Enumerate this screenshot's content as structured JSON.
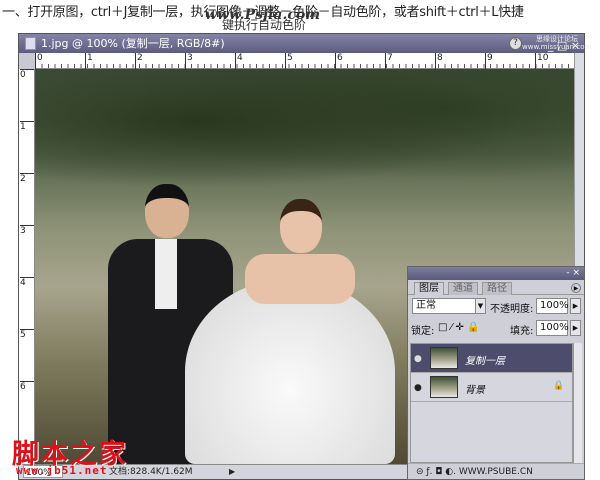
{
  "caption": {
    "line1": "一、打开原图，ctrl＋J复制一层，执行图像－调整－色阶－自动色阶，或者shift＋ctrl＋L快捷",
    "line2": "键执行自动色阶",
    "watermark": "www.Psjia.com"
  },
  "window": {
    "title": "1.jpg @ 100% (复制一层, RGB/8#)",
    "corner_watermark": "思缘设计论坛 www.missyuan.com",
    "buttons": "_ □ ×"
  },
  "ruler": {
    "top": [
      "0",
      "1",
      "2",
      "3",
      "4",
      "5",
      "6",
      "7",
      "8",
      "9",
      "10"
    ],
    "left": [
      "0",
      "1",
      "2",
      "3",
      "4",
      "5",
      "6"
    ]
  },
  "status": {
    "zoom": "100%",
    "doc": "文档:828.4K/1.62M",
    "arrow": "▶"
  },
  "watermark": {
    "brand": "脚本之家",
    "url": "www.jb51.net"
  },
  "layers_panel": {
    "title_buttons": "- ×",
    "tabs": [
      "图层",
      "通道",
      "路径"
    ],
    "blend_mode": "正常",
    "opacity_label": "不透明度:",
    "opacity": "100%",
    "lock_label": "锁定:",
    "lock_icons": "□ ⁄ ✛ 🔒",
    "fill_label": "填充:",
    "fill": "100%",
    "layers": [
      {
        "name": "复制一层",
        "selected": true
      },
      {
        "name": "背景",
        "locked": true
      }
    ],
    "footer": "⊝  ƒ.  ◘  ◐.  WWW.PSUBE.CN"
  }
}
